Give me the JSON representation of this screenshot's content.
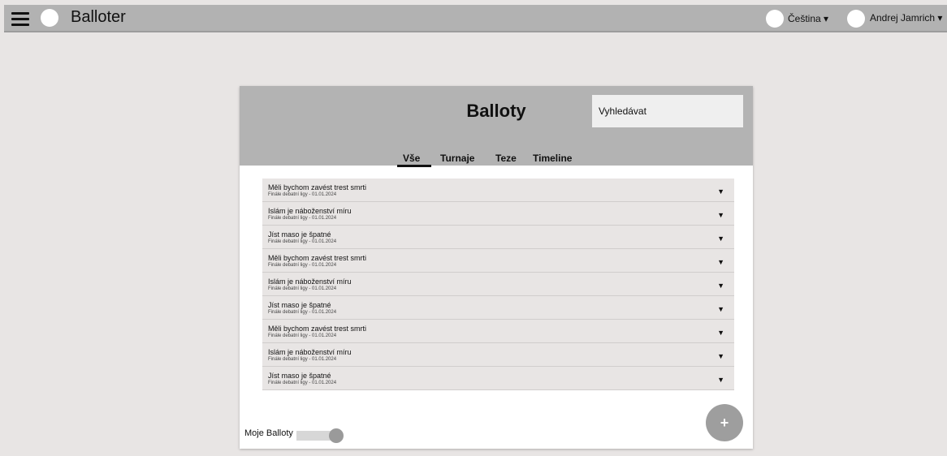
{
  "header": {
    "app_name": "Balloter",
    "language": "Čeština ▾",
    "user": "Andrej Jamrich ▾"
  },
  "card": {
    "title": "Balloty",
    "search_placeholder": "Vyhledávat",
    "tabs": [
      {
        "label": "Vše",
        "active": true
      },
      {
        "label": "Turnaje",
        "active": false
      },
      {
        "label": "Teze",
        "active": false
      },
      {
        "label": "Timeline",
        "active": false
      }
    ],
    "items": [
      {
        "title": "Měli bychom zavést trest smrti",
        "subtitle": "Finále debatní ligy - 01.01.2024"
      },
      {
        "title": "Islám je náboženství míru",
        "subtitle": "Finále debatní ligy - 01.01.2024"
      },
      {
        "title": "Jíst maso je špatné",
        "subtitle": "Finále debatní ligy - 01.01.2024"
      },
      {
        "title": "Měli bychom zavést trest smrti",
        "subtitle": "Finále debatní ligy - 01.01.2024"
      },
      {
        "title": "Islám je náboženství míru",
        "subtitle": "Finále debatní ligy - 01.01.2024"
      },
      {
        "title": "Jíst maso je špatné",
        "subtitle": "Finále debatní ligy - 01.01.2024"
      },
      {
        "title": "Měli bychom zavést trest smrti",
        "subtitle": "Finále debatní ligy - 01.01.2024"
      },
      {
        "title": "Islám je náboženství míru",
        "subtitle": "Finále debatní ligy - 01.01.2024"
      },
      {
        "title": "Jíst maso je špatné",
        "subtitle": "Finále debatní ligy - 01.01.2024"
      }
    ],
    "expand_icon": "▼",
    "my_ballots_label": "Moje Balloty",
    "my_ballots_enabled": true,
    "add_button": "+"
  },
  "colors": {
    "topbar": "#b2b2b2",
    "card_header": "#b3b3b3",
    "row": "#e8e5e4",
    "fab": "#9e9e9e"
  }
}
